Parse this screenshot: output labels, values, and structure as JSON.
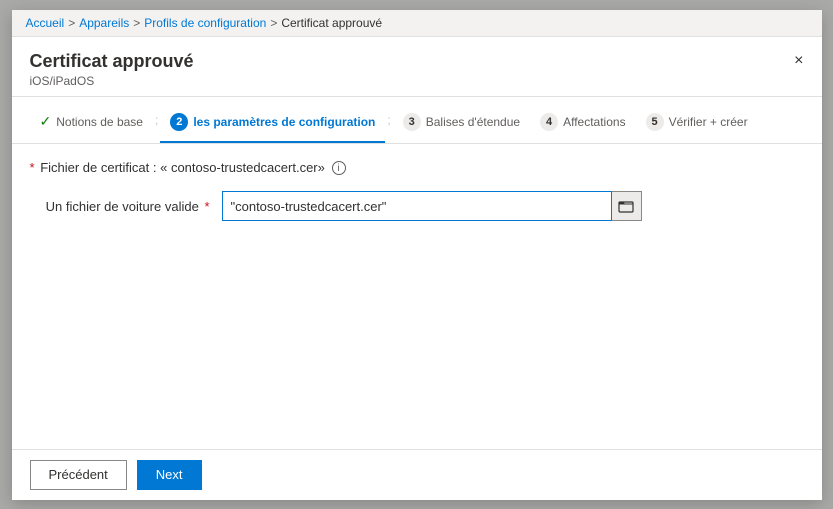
{
  "breadcrumb": {
    "item1": "Accueil",
    "sep1": ">",
    "item2": "Appareils",
    "sep2": ">",
    "item3": "Profils de configuration",
    "sep3": ">",
    "item4": "Certificat approuvé"
  },
  "modal": {
    "title": "Certificat approuvé",
    "subtitle": "iOS/iPadOS",
    "close_label": "×"
  },
  "steps": [
    {
      "id": "step-1",
      "type": "completed",
      "label": "Notions de base",
      "num": "✓"
    },
    {
      "id": "step-2",
      "type": "active",
      "label": "les paramètres de configuration",
      "num": "2"
    },
    {
      "id": "step-3",
      "type": "inactive",
      "label": "Balises d'étendue",
      "num": "3"
    },
    {
      "id": "step-4",
      "type": "inactive",
      "label": "Affectations",
      "num": "4"
    },
    {
      "id": "step-5",
      "type": "inactive",
      "label": "Vérifier + créer",
      "num": "5"
    }
  ],
  "content": {
    "cert_label": "Fichier de certificat : « contoso-trustedcacert.cer»",
    "cert_asterisk": "*",
    "field_label": "Un fichier de voiture valide",
    "field_asterisk": "*",
    "field_value": "\"contoso-trustedcacert.cer\"",
    "field_placeholder": ""
  },
  "footer": {
    "back_label": "Précédent",
    "next_label": "Next"
  },
  "icons": {
    "check": "✓",
    "info": "i",
    "folder": "📁",
    "close": "×"
  }
}
